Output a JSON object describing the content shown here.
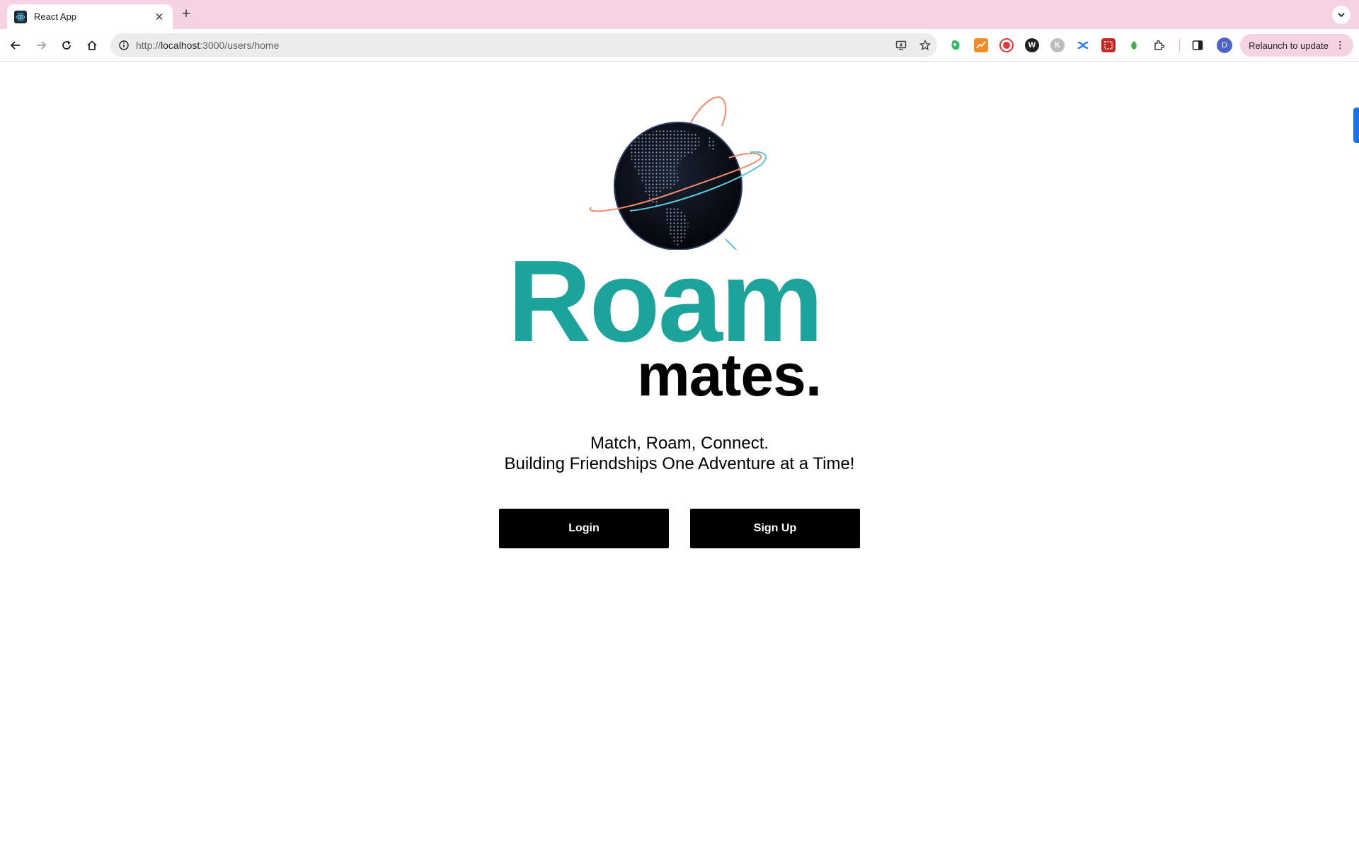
{
  "browser": {
    "tab": {
      "title": "React App",
      "close_glyph": "✕",
      "favicon": "react-icon"
    },
    "new_tab_glyph": "+",
    "address_bar": {
      "scheme": "http://",
      "host": "localhost",
      "path": ":3000/users/home"
    },
    "toolbar": {
      "back_icon": "arrow-left-icon",
      "forward_icon": "arrow-right-icon",
      "reload_icon": "reload-icon",
      "home_icon": "home-icon"
    },
    "extensions": [
      {
        "name": "evernote-extension-icon",
        "color": "#2dbe60",
        "glyph": ""
      },
      {
        "name": "chart-extension-icon",
        "color": "#f28c28",
        "glyph": ""
      },
      {
        "name": "record-extension-icon",
        "color": "#e53935",
        "glyph": ""
      },
      {
        "name": "w-extension-icon",
        "color": "#222222",
        "glyph": "W"
      },
      {
        "name": "k-extension-icon",
        "color": "#bdbdbd",
        "glyph": "K"
      },
      {
        "name": "shuffle-extension-icon",
        "color": "#1e6fff",
        "glyph": ""
      },
      {
        "name": "screenshot-extension-icon",
        "color": "#c62828",
        "glyph": ""
      },
      {
        "name": "leaf-extension-icon",
        "color": "#3cb043",
        "glyph": ""
      },
      {
        "name": "puzzle-extensions-icon",
        "color": "#ffffff",
        "glyph": ""
      }
    ],
    "profile_initial": "D",
    "relaunch_label": "Relaunch to update",
    "relaunch_dots": "⋮"
  },
  "page": {
    "brand_line1": "Roam",
    "brand_line2": "mates.",
    "tagline_line1": "Match, Roam, Connect.",
    "tagline_line2": "Building Friendships One Adventure at a Time!",
    "login_label": "Login",
    "signup_label": "Sign Up"
  },
  "colors": {
    "tab_strip": "#f6d3e3",
    "brand_teal": "#1ba39c",
    "button_bg": "#000000",
    "button_text": "#ffffff"
  }
}
